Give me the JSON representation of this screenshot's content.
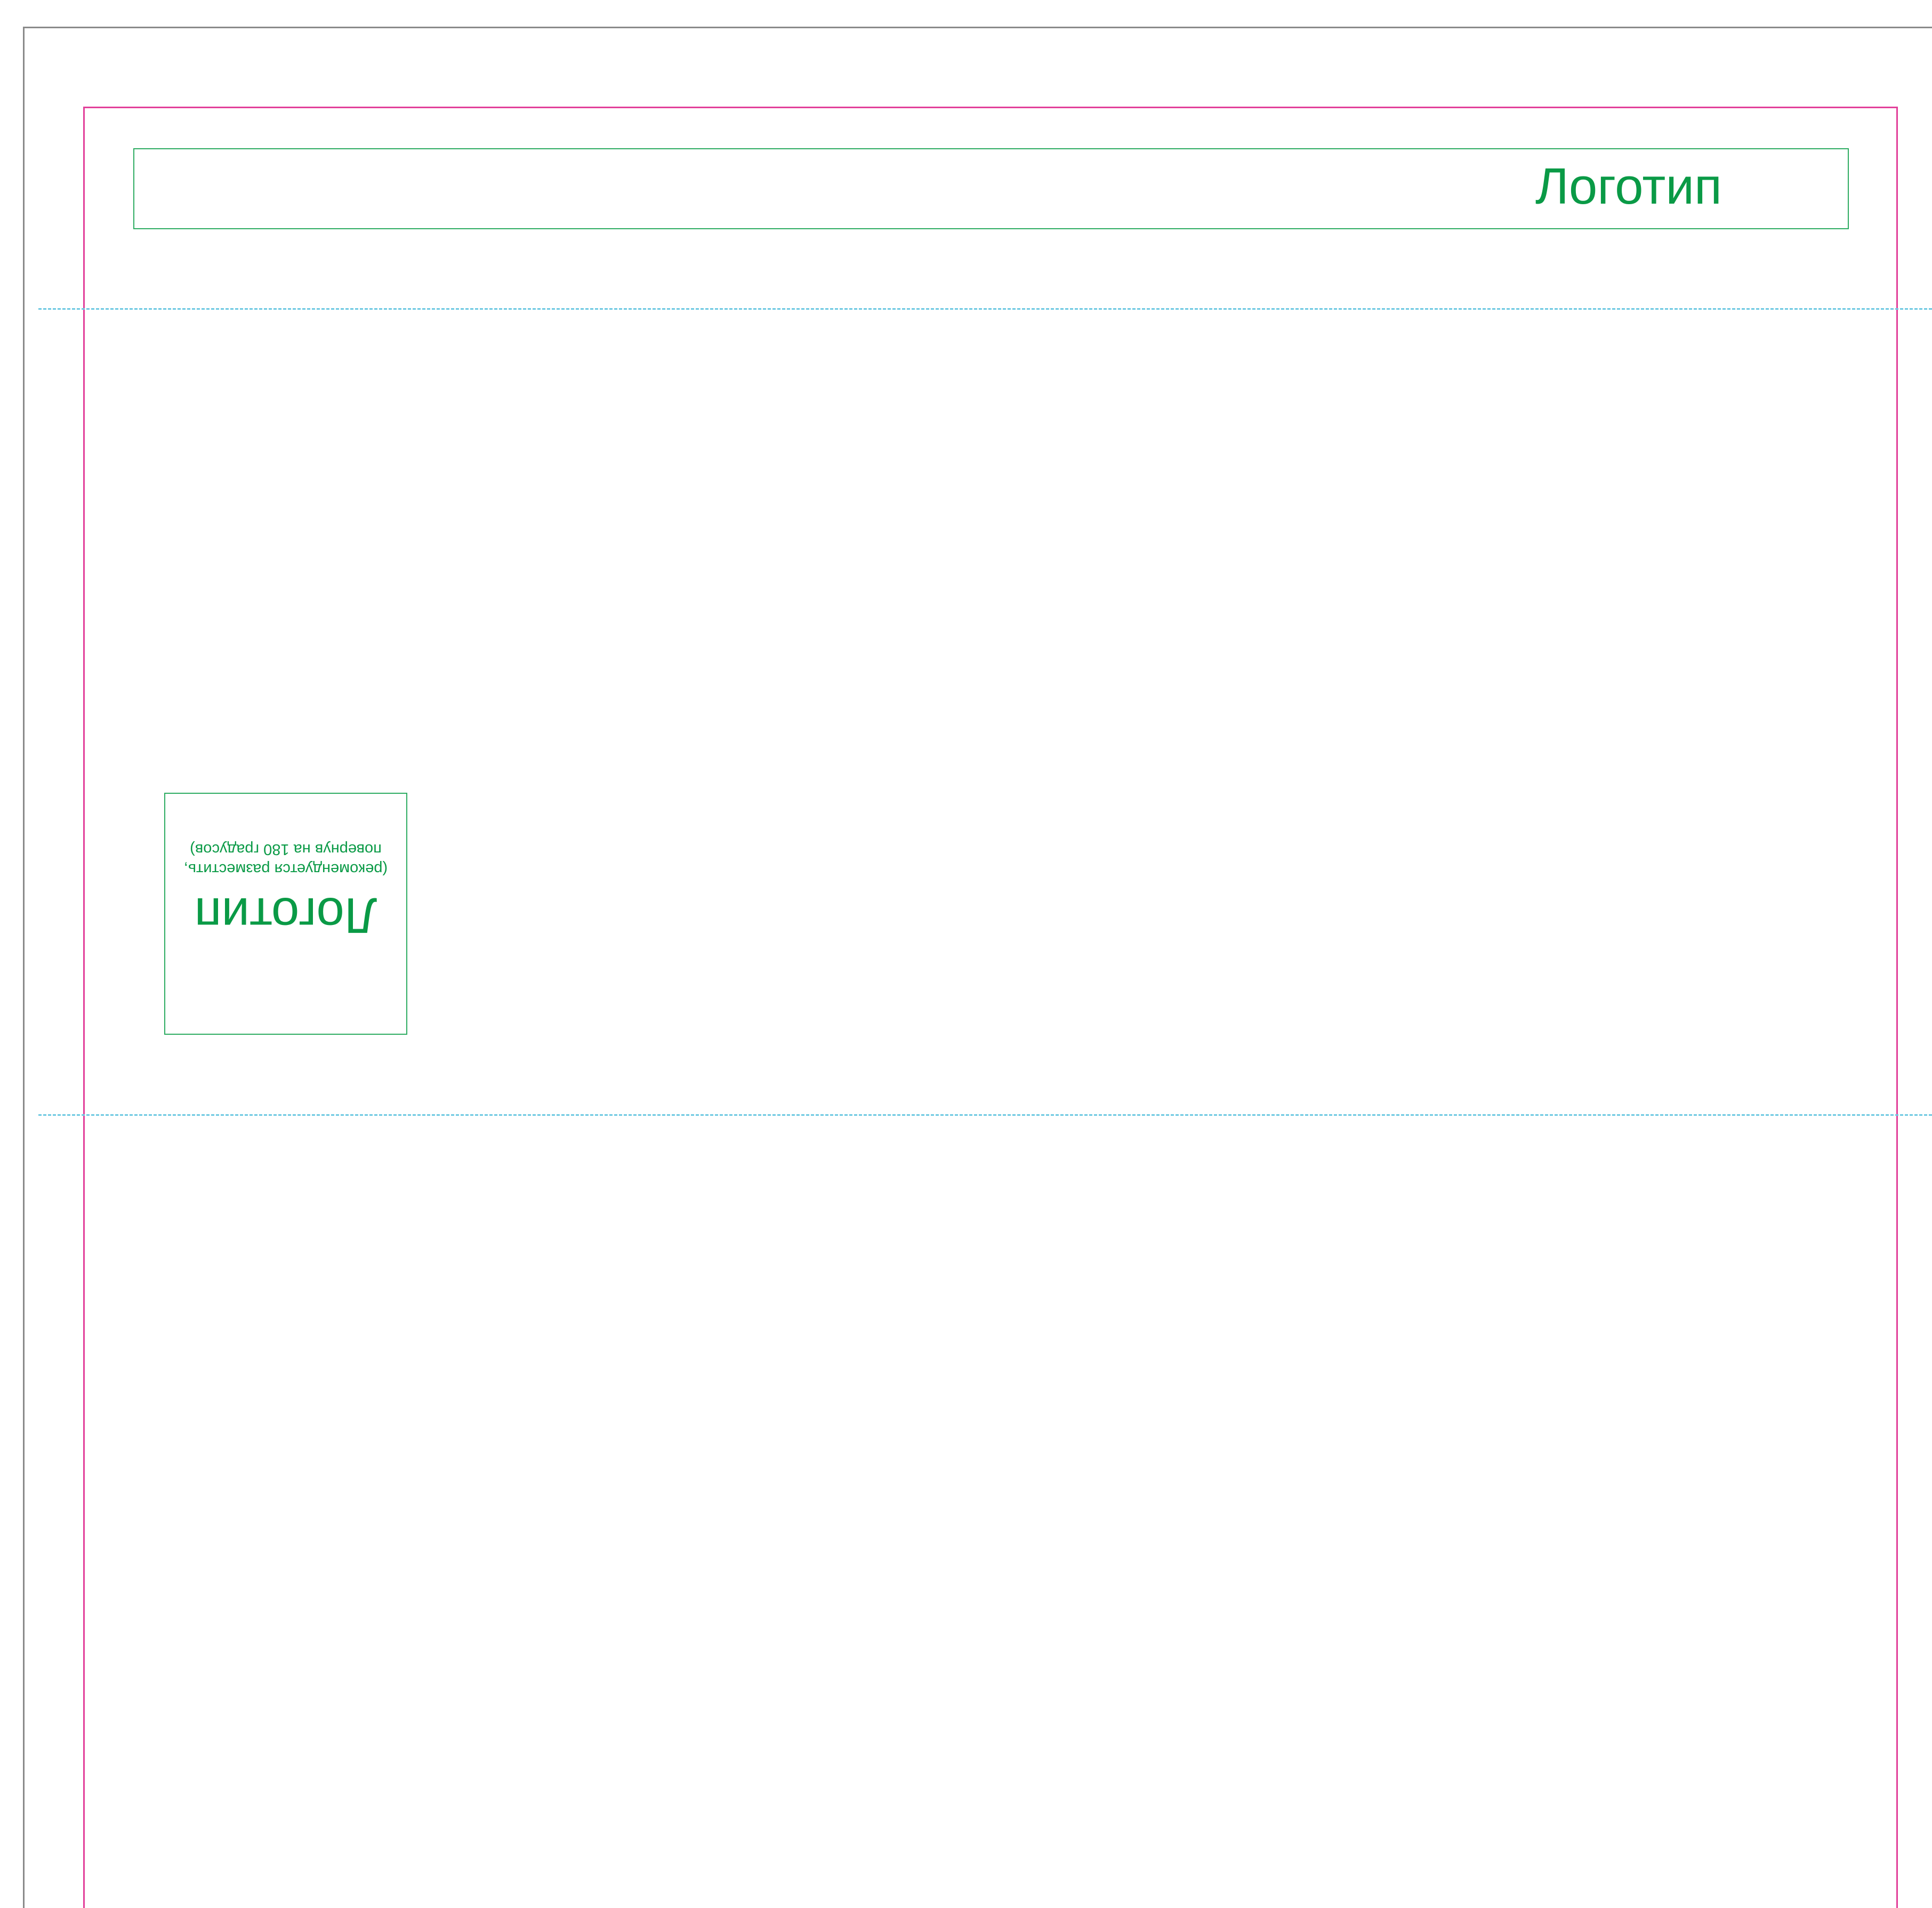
{
  "colors": {
    "page_border": "#8a8a8a",
    "bleed_line": "#e2409a",
    "fold_line": "#6fc9e2",
    "logo_frame": "#2eac62",
    "logo_text": "#0a9a46"
  },
  "header_logo": {
    "label": "Логотип"
  },
  "side_logo": {
    "label": "Логотип",
    "note_line1": "(рекомендуется разместить,",
    "note_line2": "повернув на 180 градусов)",
    "rotation_degrees": 180
  }
}
